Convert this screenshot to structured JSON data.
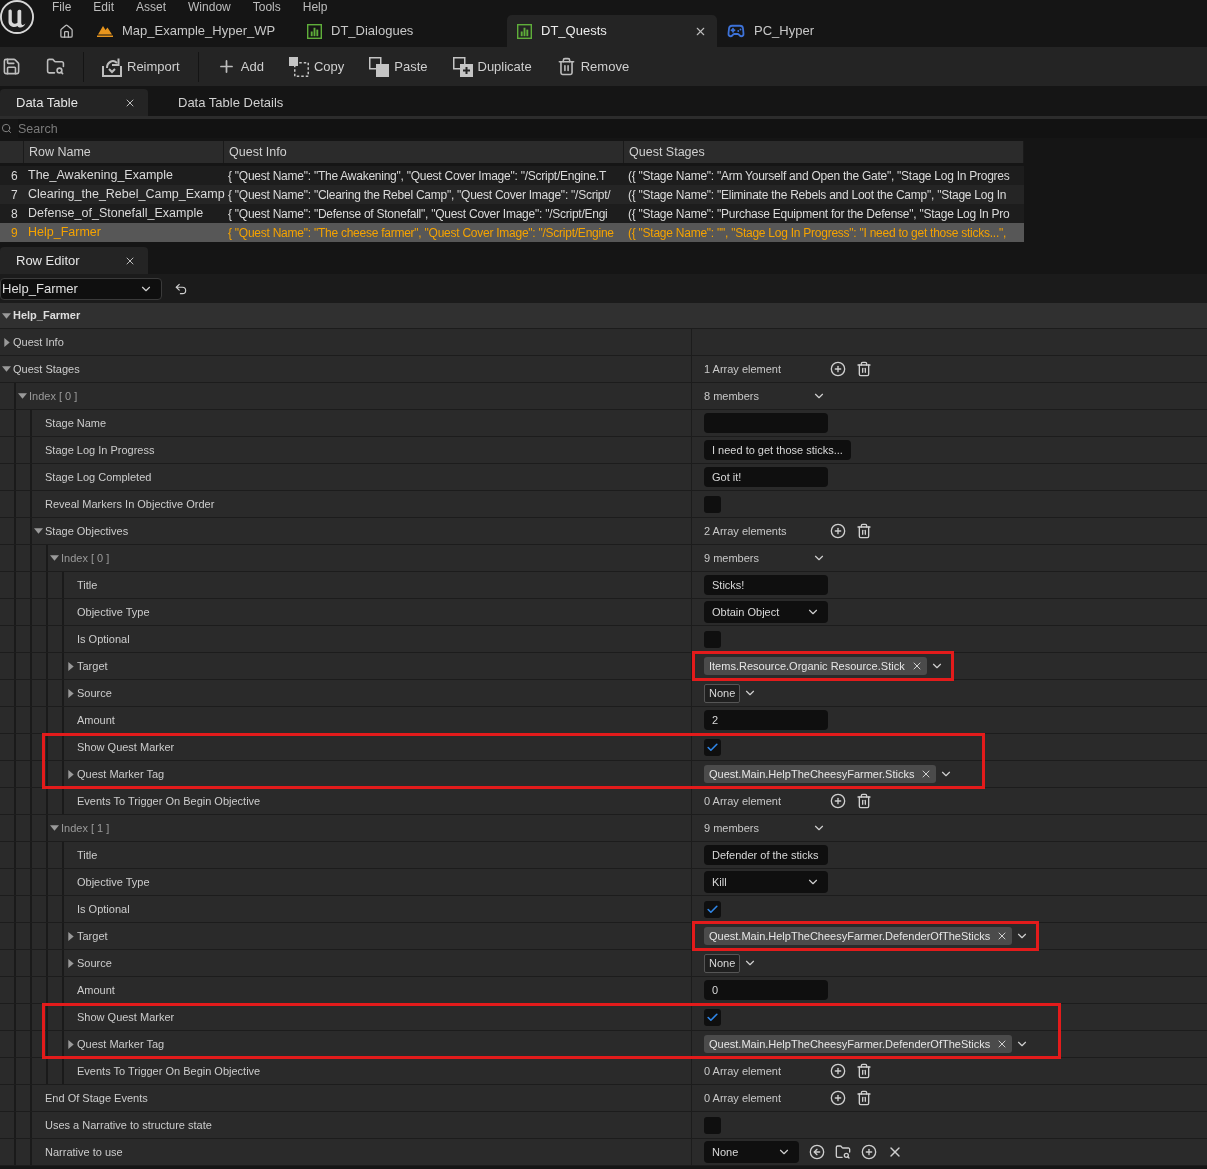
{
  "menu": [
    "File",
    "Edit",
    "Asset",
    "Window",
    "Tools",
    "Help"
  ],
  "document_tabs": [
    {
      "label": "Map_Example_Hyper_WP",
      "kind": "level",
      "selected": false
    },
    {
      "label": "DT_Dialogues",
      "kind": "data_table",
      "selected": false
    },
    {
      "label": "DT_Quests",
      "kind": "data_table",
      "selected": true
    },
    {
      "label": "PC_Hyper",
      "kind": "controller",
      "selected": false
    }
  ],
  "toolbar_groups": [
    {
      "buttons": [
        {
          "kind": "save"
        },
        {
          "kind": "browse"
        }
      ]
    },
    {
      "buttons": [
        {
          "kind": "reimport",
          "label": "Reimport"
        }
      ]
    },
    {
      "buttons": [
        {
          "kind": "add",
          "label": "Add"
        },
        {
          "kind": "copy",
          "label": "Copy"
        },
        {
          "kind": "paste",
          "label": "Paste"
        },
        {
          "kind": "duplicate",
          "label": "Duplicate"
        },
        {
          "kind": "remove",
          "label": "Remove"
        }
      ]
    }
  ],
  "panel_tabs": [
    {
      "label": "Data Table",
      "selected": true
    },
    {
      "label": "Data Table Details",
      "selected": false
    }
  ],
  "search": {
    "placeholder": "Search"
  },
  "table": {
    "columns": [
      "Row Name",
      "Quest Info",
      "Quest Stages"
    ],
    "rows": [
      {
        "number": "6",
        "selected": false,
        "cells": [
          "The_Awakening_Example",
          "{ \"Quest Name\": \"The Awakening\", \"Quest Cover Image\": \"/Script/Engine.T",
          "({ \"Stage Name\": \"Arm Yourself and Open the Gate\", \"Stage Log In Progres"
        ]
      },
      {
        "number": "7",
        "selected": false,
        "cells": [
          "Clearing_the_Rebel_Camp_Examp",
          "{ \"Quest Name\": \"Clearing the Rebel Camp\", \"Quest Cover Image\": \"/Script/",
          "({ \"Stage Name\": \"Eliminate the Rebels and Loot the Camp\", \"Stage Log In"
        ]
      },
      {
        "number": "8",
        "selected": false,
        "cells": [
          "Defense_of_Stonefall_Example",
          "{ \"Quest Name\": \"Defense of Stonefall\", \"Quest Cover Image\": \"/Script/Engi",
          "({ \"Stage Name\": \"Purchase Equipment for the Defense\", \"Stage Log In Pro"
        ]
      },
      {
        "number": "9",
        "selected": true,
        "cells": [
          "Help_Farmer",
          "{ \"Quest Name\": \"The cheese farmer\", \"Quest Cover Image\": \"/Script/Engine",
          "({ \"Stage Name\": \"\", \"Stage Log In Progress\": \"I need to get those sticks...\","
        ]
      }
    ]
  },
  "row_editor": {
    "tab": {
      "label": "Row Editor",
      "selected": true
    },
    "row_picker": {
      "value": "Help_Farmer"
    },
    "tree": {
      "label": "Help_Farmer",
      "expanded": true,
      "children": [
        {
          "kind": "property",
          "label": "Quest Info",
          "expanded": false
        },
        {
          "kind": "property",
          "label": "Quest Stages",
          "expanded": true,
          "value": {
            "kind": "array",
            "text": "1 Array element"
          },
          "children": [
            {
              "kind": "index",
              "label": "Index [ 0 ]",
              "expanded": true,
              "value": {
                "kind": "struct",
                "text": "8 members"
              },
              "children": [
                {
                  "kind": "property",
                  "label": "Stage Name",
                  "value": {
                    "kind": "text"
                  }
                },
                {
                  "kind": "property",
                  "label": "Stage Log In Progress",
                  "value": {
                    "kind": "text",
                    "text": "I need to get those sticks..."
                  }
                },
                {
                  "kind": "property",
                  "label": "Stage Log Completed",
                  "value": {
                    "kind": "text",
                    "text": "Got it!"
                  }
                },
                {
                  "kind": "property",
                  "label": "Reveal Markers In Objective Order",
                  "value": {
                    "kind": "checkbox",
                    "checked": false
                  }
                },
                {
                  "kind": "property",
                  "label": "Stage Objectives",
                  "expanded": true,
                  "value": {
                    "kind": "array",
                    "text": "2 Array elements"
                  },
                  "children": [
                    {
                      "kind": "index",
                      "label": "Index [ 0 ]",
                      "expanded": true,
                      "value": {
                        "kind": "struct",
                        "text": "9 members"
                      },
                      "children": [
                        {
                          "kind": "property",
                          "label": "Title",
                          "value": {
                            "kind": "text",
                            "text": "Sticks!"
                          }
                        },
                        {
                          "kind": "property",
                          "label": "Objective Type",
                          "value": {
                            "kind": "combo",
                            "text": "Obtain Object"
                          }
                        },
                        {
                          "kind": "property",
                          "label": "Is Optional",
                          "value": {
                            "kind": "checkbox",
                            "checked": false
                          }
                        },
                        {
                          "kind": "property",
                          "label": "Target",
                          "expanded": false,
                          "highlighted_value": true,
                          "value": {
                            "kind": "tag",
                            "text": "Items.Resource.Organic Resource.Stick"
                          }
                        },
                        {
                          "kind": "property",
                          "label": "Source",
                          "expanded": false,
                          "value": {
                            "kind": "small_combo",
                            "text": "None"
                          }
                        },
                        {
                          "kind": "property",
                          "label": "Amount",
                          "value": {
                            "kind": "text",
                            "text": "2"
                          }
                        },
                        {
                          "kind": "property",
                          "label": "Show Quest Marker",
                          "highlighted_row": true,
                          "value": {
                            "kind": "checkbox",
                            "checked": true
                          }
                        },
                        {
                          "kind": "property",
                          "label": "Quest Marker Tag",
                          "expanded": false,
                          "highlighted_row": true,
                          "value": {
                            "kind": "tag",
                            "text": "Quest.Main.HelpTheCheesyFarmer.Sticks"
                          }
                        },
                        {
                          "kind": "property",
                          "label": "Events To Trigger On Begin Objective",
                          "value": {
                            "kind": "array",
                            "text": "0 Array element"
                          }
                        }
                      ]
                    },
                    {
                      "kind": "index",
                      "label": "Index [ 1 ]",
                      "expanded": true,
                      "value": {
                        "kind": "struct",
                        "text": "9 members"
                      },
                      "children": [
                        {
                          "kind": "property",
                          "label": "Title",
                          "value": {
                            "kind": "text",
                            "text": "Defender of the sticks"
                          }
                        },
                        {
                          "kind": "property",
                          "label": "Objective Type",
                          "value": {
                            "kind": "combo",
                            "text": "Kill"
                          }
                        },
                        {
                          "kind": "property",
                          "label": "Is Optional",
                          "value": {
                            "kind": "checkbox",
                            "checked": true
                          }
                        },
                        {
                          "kind": "property",
                          "label": "Target",
                          "expanded": false,
                          "highlighted_value": true,
                          "value": {
                            "kind": "tag",
                            "text": "Quest.Main.HelpTheCheesyFarmer.DefenderOfTheSticks"
                          }
                        },
                        {
                          "kind": "property",
                          "label": "Source",
                          "expanded": false,
                          "value": {
                            "kind": "small_combo",
                            "text": "None"
                          }
                        },
                        {
                          "kind": "property",
                          "label": "Amount",
                          "value": {
                            "kind": "text",
                            "text": "0"
                          }
                        },
                        {
                          "kind": "property",
                          "label": "Show Quest Marker",
                          "highlighted_row": true,
                          "value": {
                            "kind": "checkbox",
                            "checked": true
                          }
                        },
                        {
                          "kind": "property",
                          "label": "Quest Marker Tag",
                          "expanded": false,
                          "highlighted_row": true,
                          "value": {
                            "kind": "tag",
                            "text": "Quest.Main.HelpTheCheesyFarmer.DefenderOfTheSticks"
                          }
                        },
                        {
                          "kind": "property",
                          "label": "Events To Trigger On Begin Objective",
                          "value": {
                            "kind": "array",
                            "text": "0 Array element"
                          }
                        }
                      ]
                    }
                  ]
                },
                {
                  "kind": "property",
                  "label": "End Of Stage Events",
                  "value": {
                    "kind": "array",
                    "text": "0 Array element"
                  }
                },
                {
                  "kind": "property",
                  "label": "Uses a Narrative to structure state",
                  "value": {
                    "kind": "checkbox",
                    "checked": false
                  }
                },
                {
                  "kind": "property",
                  "label": "Narrative to use",
                  "value": {
                    "kind": "asset",
                    "text": "None"
                  }
                }
              ]
            }
          ]
        }
      ]
    }
  }
}
